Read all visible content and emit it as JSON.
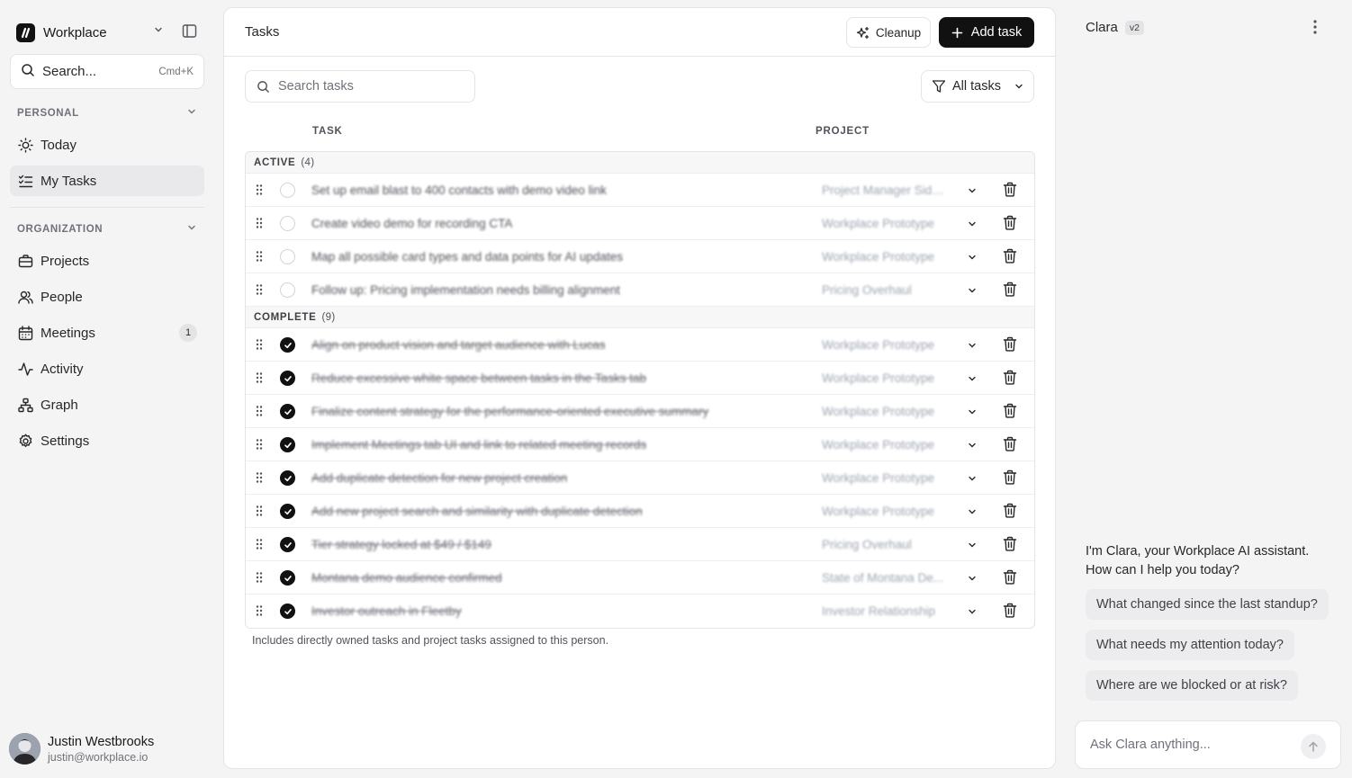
{
  "workspace": {
    "name": "Workplace"
  },
  "sidebar": {
    "search_label": "Search...",
    "search_shortcut": "Cmd+K",
    "personal_label": "PERSONAL",
    "organization_label": "ORGANIZATION",
    "personal_items": [
      {
        "label": "Today",
        "icon": "sun-icon"
      },
      {
        "label": "My Tasks",
        "icon": "list-checks-icon",
        "active": true
      }
    ],
    "org_items": [
      {
        "label": "Projects",
        "icon": "briefcase-icon"
      },
      {
        "label": "People",
        "icon": "users-icon"
      },
      {
        "label": "Meetings",
        "icon": "calendar-icon",
        "badge": "1"
      },
      {
        "label": "Activity",
        "icon": "activity-icon"
      },
      {
        "label": "Graph",
        "icon": "graph-icon"
      },
      {
        "label": "Settings",
        "icon": "gear-icon"
      }
    ],
    "user": {
      "name": "Justin Westbrooks",
      "email": "justin@workplace.io"
    }
  },
  "main": {
    "title": "Tasks",
    "cleanup_label": "Cleanup",
    "add_task_label": "Add task",
    "search_placeholder": "Search tasks",
    "filter_label": "All tasks",
    "col_task": "TASK",
    "col_project": "PROJECT",
    "groups": [
      {
        "label": "ACTIVE",
        "count": "(4)",
        "done": false,
        "tasks": [
          {
            "title": "Set up email blast to 400 contacts with demo video link",
            "project": "Project Manager Side..."
          },
          {
            "title": "Create video demo for recording CTA",
            "project": "Workplace Prototype"
          },
          {
            "title": "Map all possible card types and data points for AI updates",
            "project": "Workplace Prototype"
          },
          {
            "title": "Follow up: Pricing implementation needs billing alignment",
            "project": "Pricing Overhaul"
          }
        ]
      },
      {
        "label": "COMPLETE",
        "count": "(9)",
        "done": true,
        "tasks": [
          {
            "title": "Align on product vision and target audience with Lucas",
            "project": "Workplace Prototype"
          },
          {
            "title": "Reduce excessive white space between tasks in the Tasks tab",
            "project": "Workplace Prototype"
          },
          {
            "title": "Finalize content strategy for the performance-oriented executive summary",
            "project": "Workplace Prototype"
          },
          {
            "title": "Implement Meetings tab UI and link to related meeting records",
            "project": "Workplace Prototype"
          },
          {
            "title": "Add duplicate detection for new project creation",
            "project": "Workplace Prototype"
          },
          {
            "title": "Add new project search and similarity with duplicate detection",
            "project": "Workplace Prototype"
          },
          {
            "title": "Tier strategy locked at $49 / $149",
            "project": "Pricing Overhaul"
          },
          {
            "title": "Montana demo audience confirmed",
            "project": "State of Montana De..."
          },
          {
            "title": "Investor outreach in Fleetby",
            "project": "Investor Relationship"
          }
        ]
      }
    ],
    "footnote": "Includes directly owned tasks and project tasks assigned to this person."
  },
  "assistant": {
    "name": "Clara",
    "version": "v2",
    "greeting": "I'm Clara, your Workplace AI assistant. How can I help you today?",
    "suggestions": [
      "What changed since the last standup?",
      "What needs my attention today?",
      "Where are we blocked or at risk?"
    ],
    "input_placeholder": "Ask Clara anything..."
  }
}
